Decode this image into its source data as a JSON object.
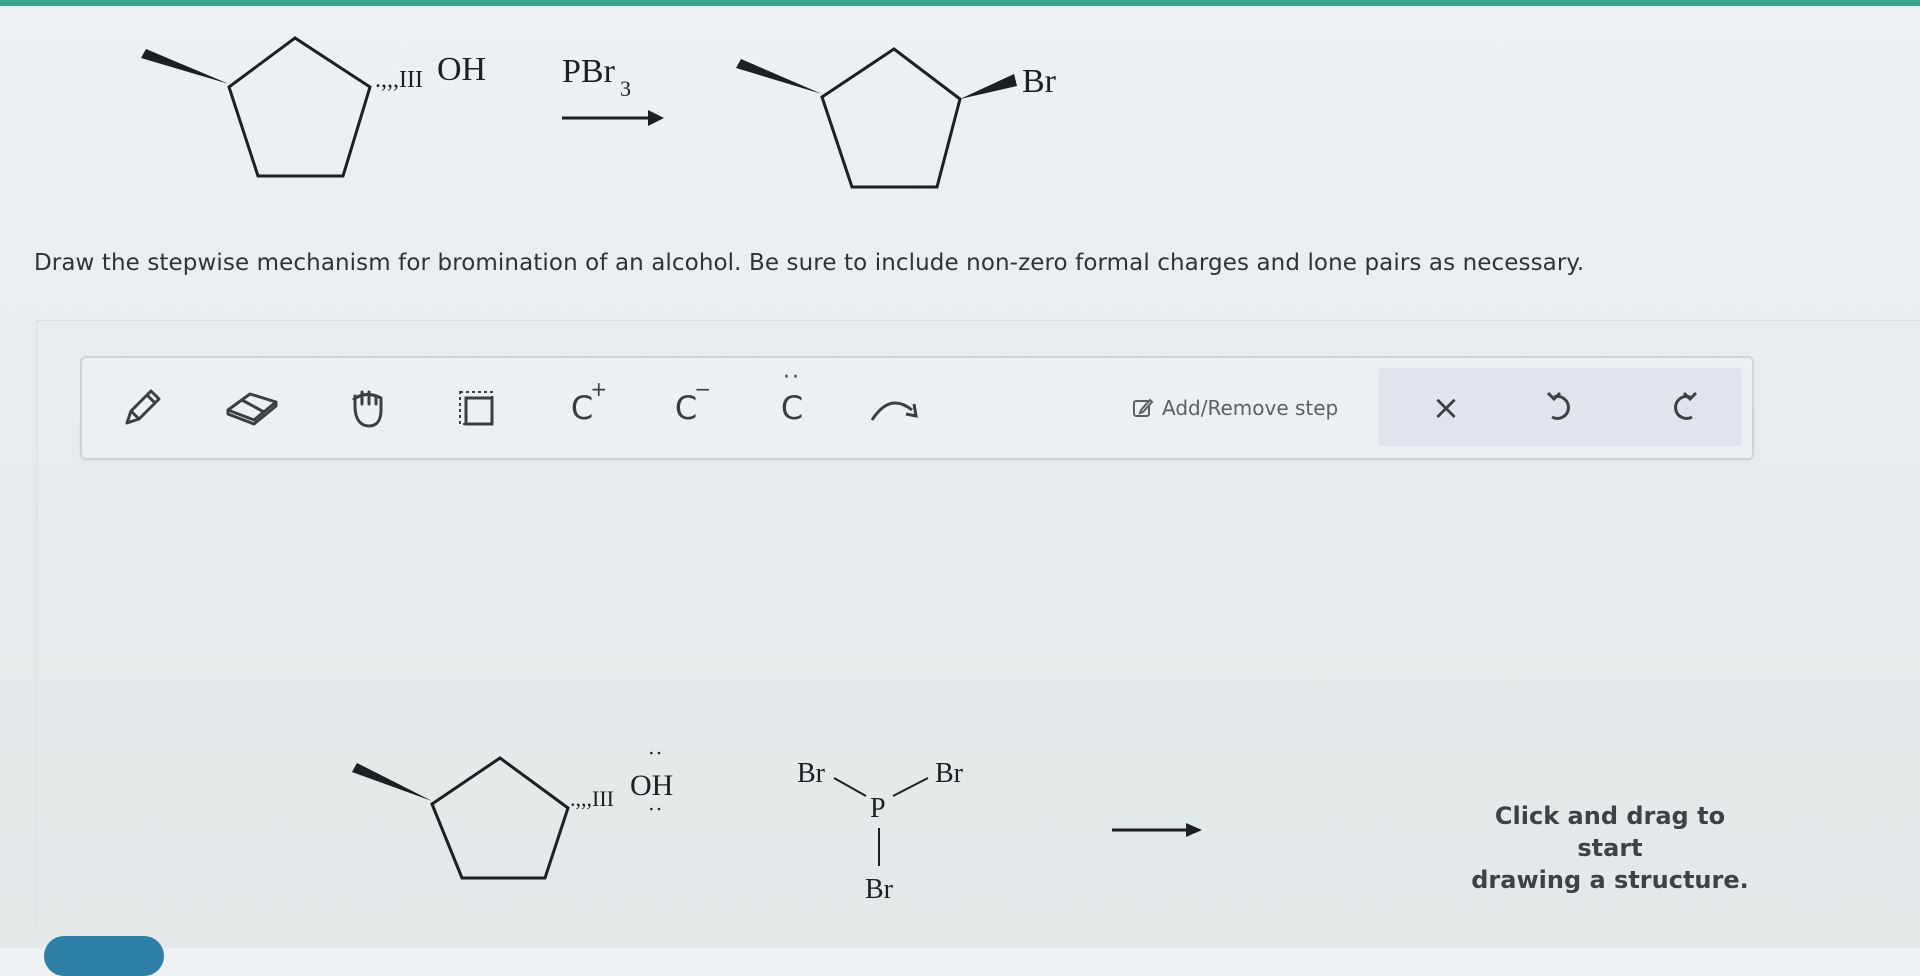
{
  "reaction": {
    "reactant_label": "OH",
    "reagent": "PBr",
    "reagent_subscript": "3",
    "product_label": "Br"
  },
  "question": {
    "text": "Draw the stepwise mechanism for bromination of an alcohol. Be sure to include non-zero formal charges and lone pairs as necessary."
  },
  "toolbar": {
    "tools": [
      {
        "name": "pencil-icon"
      },
      {
        "name": "eraser-icon"
      },
      {
        "name": "hand-icon"
      },
      {
        "name": "select-box-icon"
      },
      {
        "name": "carbocation-tool",
        "label": "C",
        "superscript": "+"
      },
      {
        "name": "carbanion-tool",
        "label": "C",
        "superscript": "−"
      },
      {
        "name": "lone-pair-tool",
        "label": "C",
        "dots": "··"
      },
      {
        "name": "curved-arrow-icon"
      }
    ],
    "add_remove_step": "Add/Remove step",
    "clear_symbol": "×"
  },
  "canvas": {
    "alcohol_label": "OH",
    "alcohol_lone_pairs": ":",
    "pbr3_atoms": {
      "p": "P",
      "br_left": "Br",
      "br_right": "Br",
      "br_bottom": "Br"
    },
    "hint_line1": "Click and drag to start",
    "hint_line2": "drawing a structure."
  },
  "colors": {
    "accent": "#3aa58a",
    "panel": "#dfe5ea",
    "button": "#2e7fa8"
  }
}
